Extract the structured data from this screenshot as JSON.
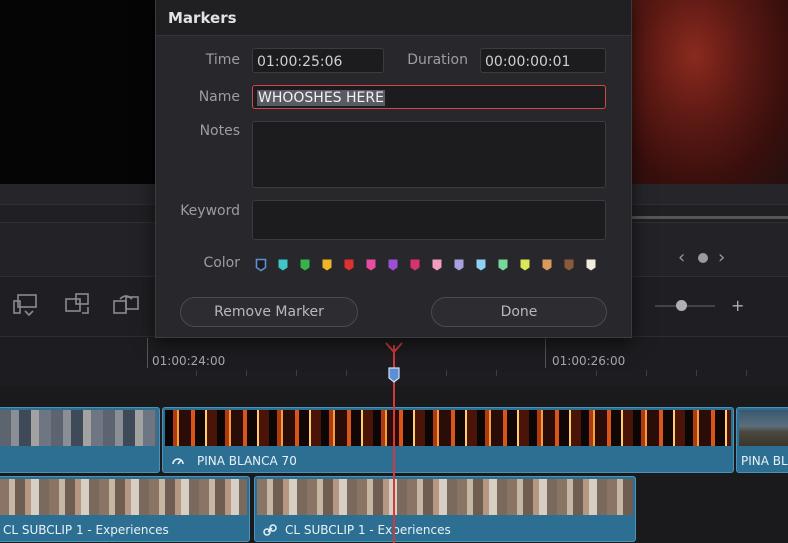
{
  "dialog": {
    "title": "Markers",
    "time_label": "Time",
    "time_value": "01:00:25:06",
    "duration_label": "Duration",
    "duration_value": "00:00:00:01",
    "name_label": "Name",
    "name_value": "WHOOSHES HERE",
    "notes_label": "Notes",
    "notes_value": "",
    "keyword_label": "Keyword",
    "keyword_value": "",
    "color_label": "Color",
    "colors": [
      {
        "name": "Blue",
        "hex": "#5b8fd6",
        "selected": true
      },
      {
        "name": "Cyan",
        "hex": "#3fc6c9",
        "selected": false
      },
      {
        "name": "Green",
        "hex": "#37b24d",
        "selected": false
      },
      {
        "name": "Yellow",
        "hex": "#f0b429",
        "selected": false
      },
      {
        "name": "Red",
        "hex": "#e03131",
        "selected": false
      },
      {
        "name": "Pink",
        "hex": "#e64ca0",
        "selected": false
      },
      {
        "name": "Purple",
        "hex": "#9c4fd6",
        "selected": false
      },
      {
        "name": "Fuchsia",
        "hex": "#d6336c",
        "selected": false
      },
      {
        "name": "Rose",
        "hex": "#f59bc0",
        "selected": false
      },
      {
        "name": "Lavender",
        "hex": "#a9a2e0",
        "selected": false
      },
      {
        "name": "Sky",
        "hex": "#8fd0f5",
        "selected": false
      },
      {
        "name": "Mint",
        "hex": "#74d99a",
        "selected": false
      },
      {
        "name": "Lemon",
        "hex": "#d9e85a",
        "selected": false
      },
      {
        "name": "Sand",
        "hex": "#d99a5b",
        "selected": false
      },
      {
        "name": "Cocoa",
        "hex": "#8a5a3c",
        "selected": false
      },
      {
        "name": "Cream",
        "hex": "#f2ecdc",
        "selected": false
      }
    ],
    "remove_button": "Remove Marker",
    "done_button": "Done"
  },
  "timeline": {
    "ruler_labels": [
      "01:00:24:00",
      "01:00:26:00"
    ],
    "tracks": [
      {
        "clips": [
          {
            "name": "",
            "thumbs": "people",
            "icon": "none"
          },
          {
            "name": "PINA BLANCA 70",
            "thumbs": "fire",
            "icon": "speed-icon"
          },
          {
            "name": "PINA BLA",
            "thumbs": "land",
            "icon": "none"
          }
        ]
      },
      {
        "clips": [
          {
            "name": "CL SUBCLIP 1 - Experiences",
            "thumbs": "group",
            "icon": "none"
          },
          {
            "name": "CL SUBCLIP 1 - Experiences",
            "thumbs": "group",
            "icon": "link-icon"
          }
        ]
      }
    ]
  },
  "toolbar": {
    "icons": [
      "insert-clip-icon",
      "overwrite-clip-icon",
      "replace-clip-icon"
    ],
    "nav_icons": [
      "chevron-left-icon",
      "page-dot-icon",
      "chevron-right-icon"
    ],
    "zoom_icon": "zoom-in-icon"
  },
  "colors": {
    "accent_playhead": "#d23a3a",
    "clip_fill": "#2d6f92",
    "dialog_bg": "#28282c"
  }
}
